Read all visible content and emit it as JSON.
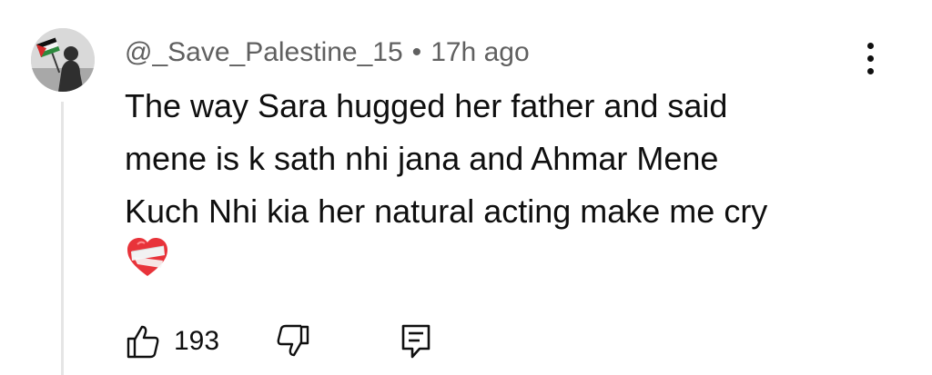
{
  "comment": {
    "author": "@_Save_Palestine_15",
    "separator": "•",
    "time": "17h ago",
    "text_lines": [
      "The way Sara hugged her father and said",
      "mene is k sath nhi jana and Ahmar Mene",
      "Kuch Nhi kia her natural acting make me cry"
    ],
    "emoji": "mending-heart-icon",
    "like_count": "193"
  },
  "icons": {
    "avatar": "palestine-flag-avatar",
    "menu": "more-vertical-icon",
    "like": "thumbs-up-icon",
    "dislike": "thumbs-down-icon",
    "reply": "comment-reply-icon"
  },
  "colors": {
    "meta_text": "#606060",
    "body_text": "#0f0f0f",
    "thread_line": "#e5e5e5",
    "heart": "#e8333a"
  }
}
